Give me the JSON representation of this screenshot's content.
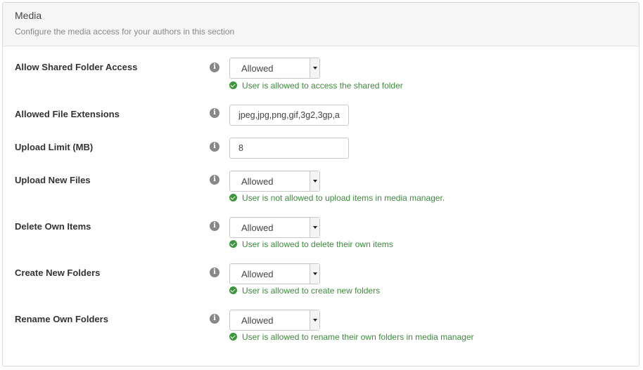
{
  "panel": {
    "title": "Media",
    "subtitle": "Configure the media access for your authors in this section"
  },
  "fields": [
    {
      "label": "Allow Shared Folder Access",
      "type": "select",
      "value": "Allowed",
      "hint": "User is allowed to access the shared folder"
    },
    {
      "label": "Allowed File Extensions",
      "type": "text",
      "value": "jpeg,jpg,png,gif,3g2,3gp,a"
    },
    {
      "label": "Upload Limit (MB)",
      "type": "text",
      "value": "8"
    },
    {
      "label": "Upload New Files",
      "type": "select",
      "value": "Allowed",
      "hint": "User is not allowed to upload items in media manager."
    },
    {
      "label": "Delete Own Items",
      "type": "select",
      "value": "Allowed",
      "hint": "User is allowed to delete their own items"
    },
    {
      "label": "Create New Folders",
      "type": "select",
      "value": "Allowed",
      "hint": "User is allowed to create new folders"
    },
    {
      "label": "Rename Own Folders",
      "type": "select",
      "value": "Allowed",
      "hint": "User is allowed to rename their own folders in media manager"
    }
  ],
  "icons": {
    "info": "info-icon",
    "check": "check-circle-icon"
  },
  "colors": {
    "hint_green": "#3d8b3d",
    "header_bg": "#f6f6f6",
    "info_gray": "#888888"
  }
}
